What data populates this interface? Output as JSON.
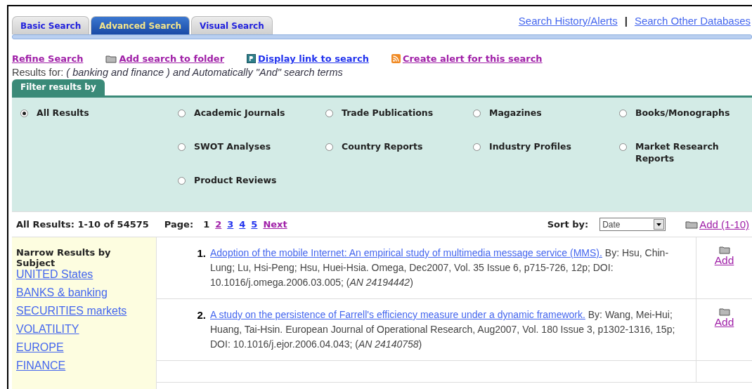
{
  "tabs": [
    {
      "label": "Basic Search",
      "selected": false
    },
    {
      "label": "Advanced Search",
      "selected": true
    },
    {
      "label": "Visual Search",
      "selected": false
    }
  ],
  "top_links": [
    {
      "label": "Search History/Alerts"
    },
    {
      "label": "Search Other Databases"
    }
  ],
  "top_separator": "|",
  "actions": [
    {
      "label": "Refine Search",
      "kind": "plain",
      "visited": true
    },
    {
      "label": "Add search to folder",
      "kind": "folder",
      "visited": true
    },
    {
      "label": "Display link to search",
      "kind": "permalink",
      "visited": false
    },
    {
      "label": "Create alert for this search",
      "kind": "rss",
      "visited": true
    }
  ],
  "results_for": {
    "label": "Results for:",
    "query": "( banking and finance ) and Automatically \"And\" search terms"
  },
  "filter": {
    "title": "Filter results by",
    "options": [
      {
        "label": "All Results",
        "selected": true
      },
      {
        "label": "Academic Journals",
        "selected": false
      },
      {
        "label": "Trade Publications",
        "selected": false
      },
      {
        "label": "Magazines",
        "selected": false
      },
      {
        "label": "Books/Monographs",
        "selected": false
      },
      {
        "label": "SWOT Analyses",
        "selected": false
      },
      {
        "label": "Country Reports",
        "selected": false
      },
      {
        "label": "Industry Profiles",
        "selected": false
      },
      {
        "label": "Market Research Reports",
        "selected": false
      },
      {
        "label": "Product Reviews",
        "selected": false
      }
    ]
  },
  "results_bar": {
    "count": "All Results: 1-10 of 54575",
    "page_label": "Page:",
    "pages": [
      {
        "label": "1",
        "selected": true
      },
      {
        "label": "2",
        "selected": false,
        "visited": true
      },
      {
        "label": "3",
        "selected": false,
        "visited": false
      },
      {
        "label": "4",
        "selected": false,
        "visited": false
      },
      {
        "label": "5",
        "selected": false,
        "visited": false
      },
      {
        "label": "Next",
        "selected": false,
        "visited": true
      }
    ],
    "sort_label": "Sort by:",
    "sort_value": "Date",
    "add_all": "Add (1-10)"
  },
  "narrow": {
    "title": "Narrow Results by Subject",
    "subjects": [
      "UNITED States",
      "BANKS & banking",
      "SECURITIES markets",
      "VOLATILITY",
      "EUROPE",
      "FINANCE"
    ]
  },
  "results": [
    {
      "number": "1.",
      "title": "Adoption of the mobile Internet: An empirical study of multimedia message service (MMS).",
      "details": "By: Hsu, Chin-Lung; Lu, Hsi-Peng; Hsu, Huei-Hsia. Omega, Dec2007, Vol. 35 Issue 6, p715-726, 12p; DOI: 10.1016/j.omega.2006.03.005; (*AN 24194442*)",
      "add": "Add"
    },
    {
      "number": "2.",
      "title": "A study on the persistence of Farrell's efficiency measure under a dynamic framework.",
      "details": "By: Wang, Mei-Hui; Huang, Tai-Hsin. European Journal of Operational Research, Aug2007, Vol. 180 Issue 3, p1302-1316, 15p; DOI: 10.1016/j.ejor.2006.04.043; (*AN 24140758*)",
      "add": "Add"
    }
  ]
}
